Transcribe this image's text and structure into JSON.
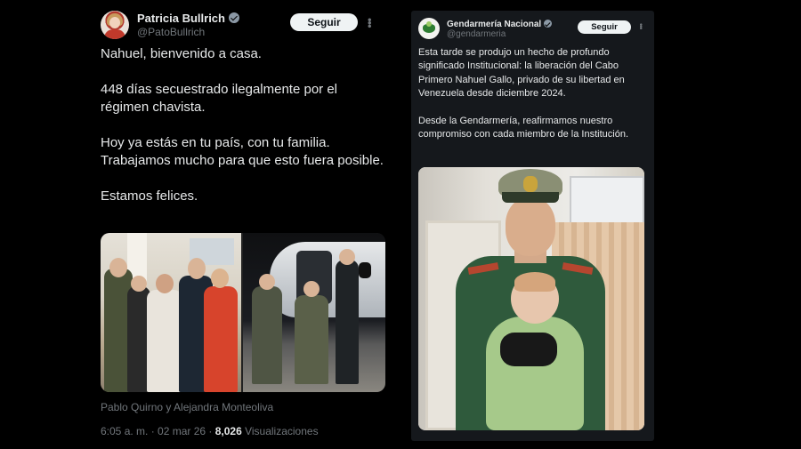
{
  "left_tweet": {
    "author_name": "Patricia Bullrich",
    "author_handle": "@PatoBullrich",
    "follow_label": "Seguir",
    "paragraphs": [
      "Nahuel, bienvenido a casa.",
      "448 días secuestrado ilegalmente por el régimen chavista.",
      "Hoy ya estás en tu país, con tu familia. Trabajamos mucho para que esto fuera posible.",
      "Estamos felices."
    ],
    "media_caption": "Pablo Quirno y Alejandra Monteoliva",
    "time": "6:05 a. m. · 02 mar 26 · ",
    "views_count": "8,026",
    "views_label": " Visualizaciones"
  },
  "right_tweet": {
    "author_name": "Gendarmería Nacional",
    "author_handle": "@gendarmeria",
    "follow_label": "Seguir",
    "paragraphs": [
      "Esta tarde se produjo un hecho de profundo significado Institucional: la liberación del Cabo Primero Nahuel Gallo, privado de su libertad en Venezuela desde diciembre 2024.",
      "Desde la Gendarmería, reafirmamos nuestro compromiso con cada miembro de la Institución."
    ]
  },
  "icons": {
    "verified": "verified-badge-icon",
    "more": "more-options-icon"
  },
  "colors": {
    "background": "#000000",
    "card_background": "#15181c",
    "text_primary": "#e7e9ea",
    "text_secondary": "#71767b",
    "follow_button_bg": "#eff3f4"
  }
}
